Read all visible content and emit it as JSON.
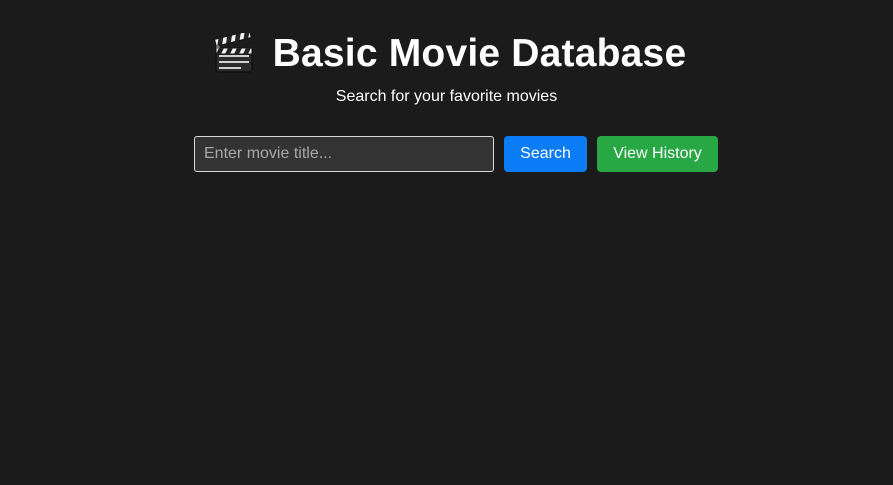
{
  "header": {
    "icon": "clapperboard-icon",
    "title": "Basic Movie Database",
    "subtitle": "Search for your favorite movies"
  },
  "search": {
    "value": "",
    "placeholder": "Enter movie title...",
    "search_label": "Search",
    "history_label": "View History"
  },
  "colors": {
    "background": "#1b1b1b",
    "search_button": "#0a7cf5",
    "history_button": "#28a745",
    "input_background": "#333333"
  }
}
